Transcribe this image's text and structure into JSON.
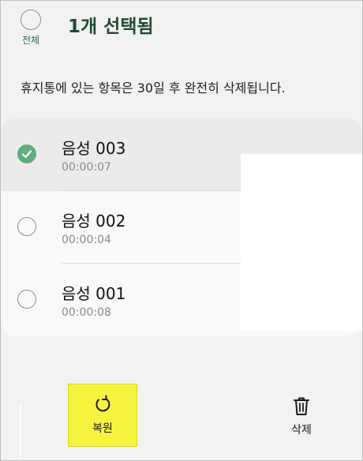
{
  "header": {
    "select_all_label": "전체",
    "title": "1개 선택됨"
  },
  "notice": "휴지통에 있는 항목은 30일 후 완전히 삭제됩니다.",
  "items": [
    {
      "name": "음성 003",
      "duration": "00:00:07",
      "selected": true
    },
    {
      "name": "음성 002",
      "duration": "00:00:04",
      "selected": false
    },
    {
      "name": "음성 001",
      "duration": "00:00:08",
      "selected": false
    }
  ],
  "actions": {
    "restore_label": "복원",
    "delete_label": "삭제"
  },
  "colors": {
    "accent": "#5fae7c",
    "title": "#1f4b33",
    "highlight": "#f6f33f"
  },
  "icons": {
    "select_all": "radio-circle-icon",
    "checked": "check-circle-icon",
    "restore": "restore-arrow-icon",
    "delete": "trash-icon"
  }
}
